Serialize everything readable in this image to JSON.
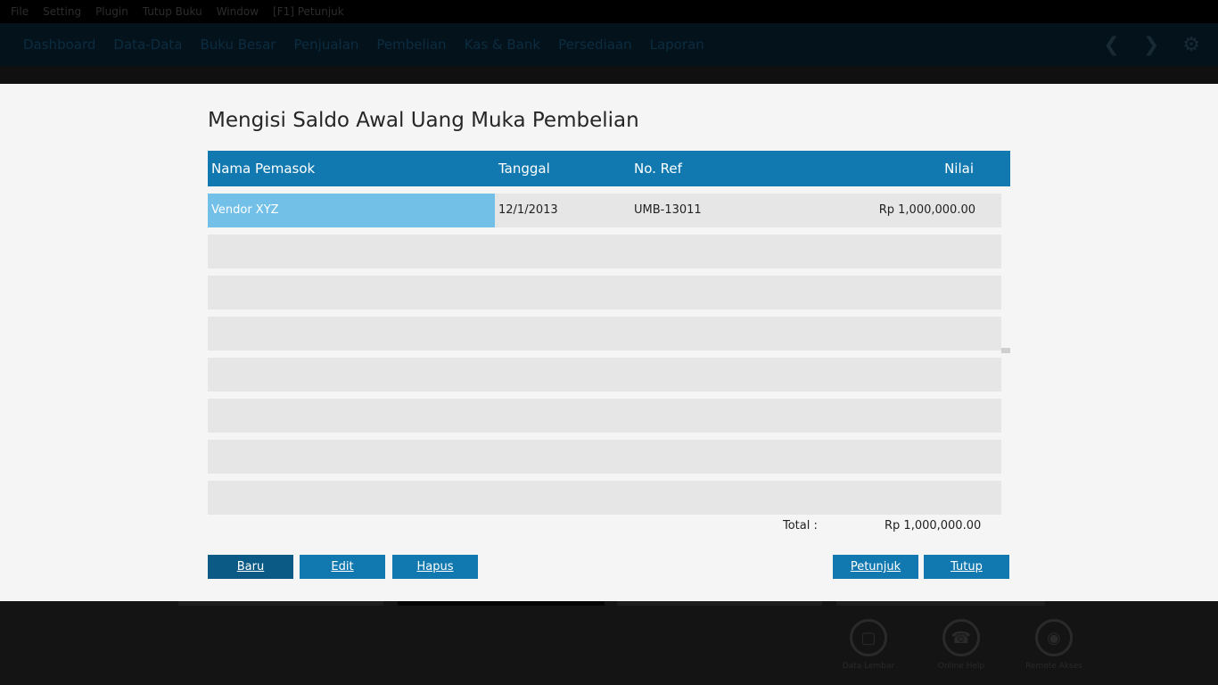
{
  "app": {
    "menu": [
      "File",
      "Setting",
      "Plugin",
      "Tutup Buku",
      "Window",
      "[F1] Petunjuk"
    ],
    "nav": [
      "Dashboard",
      "Data-Data",
      "Buku Besar",
      "Penjualan",
      "Pembelian",
      "Kas & Bank",
      "Persediaan",
      "Laporan"
    ],
    "shortcuts": [
      {
        "label": "Data Lembar",
        "icon": "save-icon"
      },
      {
        "label": "Online Help",
        "icon": "phone-icon"
      },
      {
        "label": "Remote Akses",
        "icon": "globe-icon"
      }
    ]
  },
  "dialog": {
    "title": "Mengisi Saldo Awal Uang Muka Pembelian",
    "columns": {
      "supplier": "Nama Pemasok",
      "date": "Tanggal",
      "ref": "No. Ref",
      "value": "Nilai"
    },
    "rows": [
      {
        "supplier": "Vendor XYZ",
        "date": "12/1/2013",
        "ref": "UMB-13011",
        "value": "Rp 1,000,000.00"
      }
    ],
    "total_label": "Total :",
    "total_value": "Rp 1,000,000.00",
    "buttons": {
      "new": "Baru",
      "edit": "Edit",
      "delete": "Hapus",
      "help": "Petunjuk",
      "close": "Tutup"
    }
  }
}
